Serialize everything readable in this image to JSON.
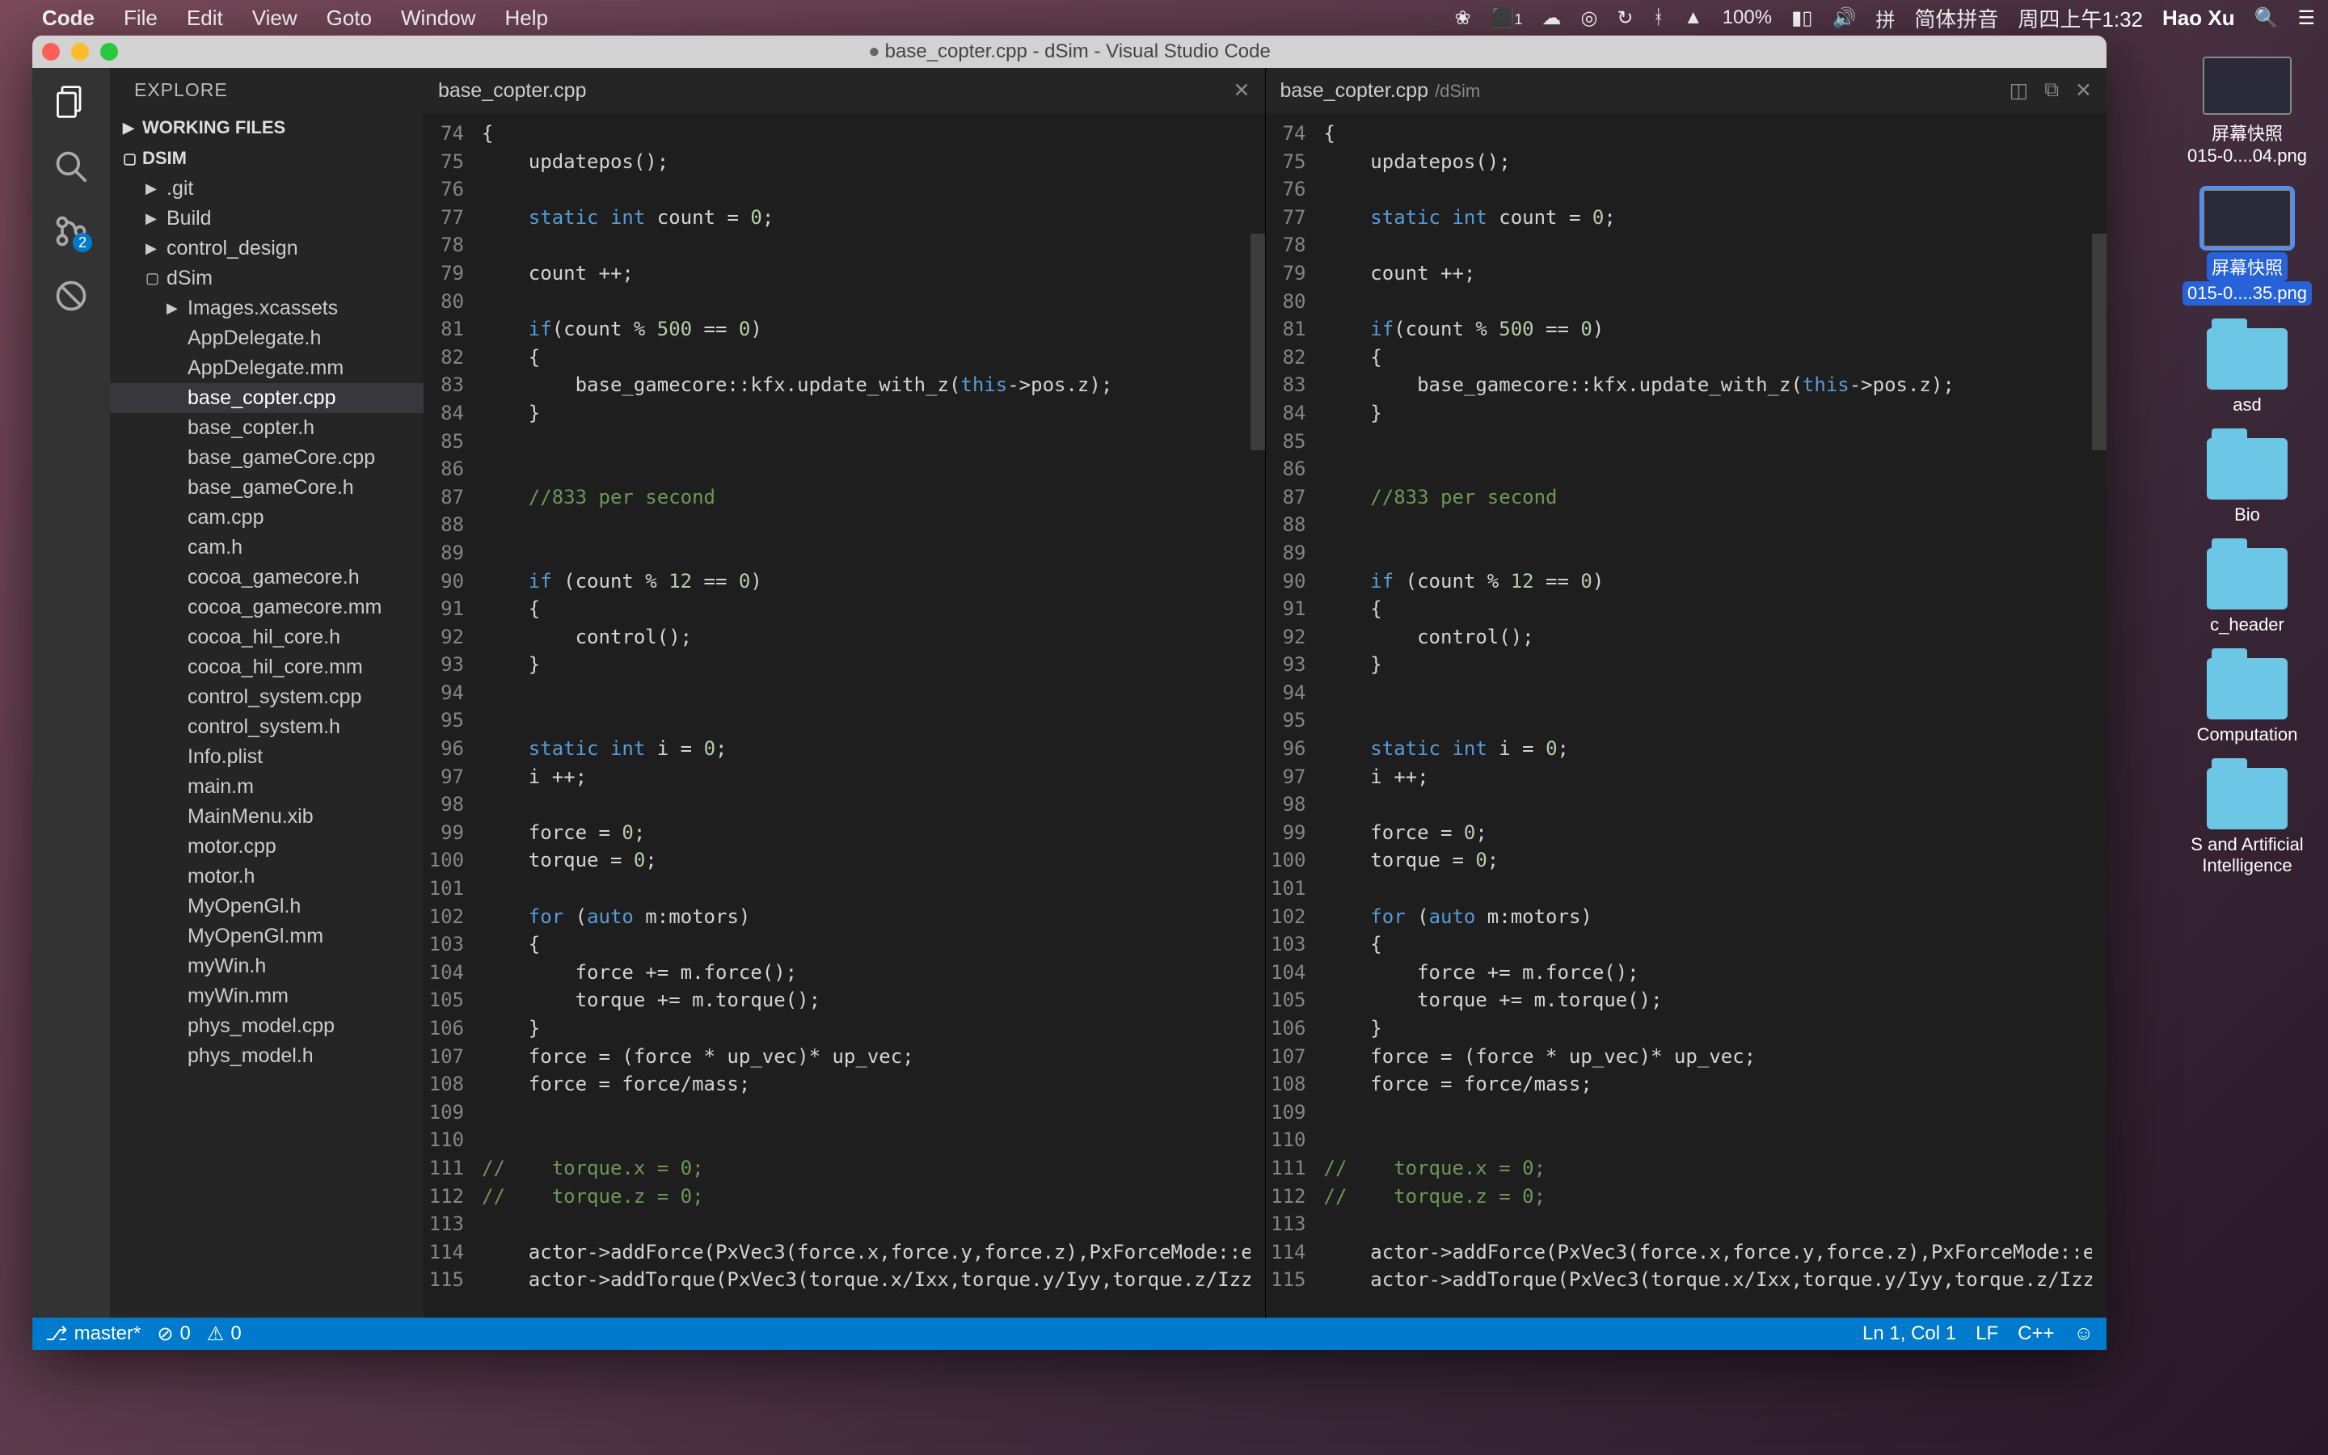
{
  "menubar": {
    "app": "Code",
    "items": [
      "File",
      "Edit",
      "View",
      "Goto",
      "Window",
      "Help"
    ],
    "right": {
      "adobe_badge": "1",
      "battery": "100%",
      "ime": "简体拼音",
      "datetime": "周四上午1:32",
      "user": "Hao Xu"
    }
  },
  "titlebar": "base_copter.cpp - dSim - Visual Studio Code",
  "activity": {
    "git_badge": "2"
  },
  "sidebar": {
    "title": "EXPLORE",
    "sections": {
      "working": "WORKING FILES",
      "project": "DSIM"
    },
    "tree": [
      {
        "label": ".git",
        "indent": 1,
        "folder": true,
        "collapsed": true
      },
      {
        "label": "Build",
        "indent": 1,
        "folder": true,
        "collapsed": true
      },
      {
        "label": "control_design",
        "indent": 1,
        "folder": true,
        "collapsed": true
      },
      {
        "label": "dSim",
        "indent": 1,
        "folder": true,
        "collapsed": false
      },
      {
        "label": "Images.xcassets",
        "indent": 2,
        "folder": true,
        "collapsed": true
      },
      {
        "label": "AppDelegate.h",
        "indent": 2
      },
      {
        "label": "AppDelegate.mm",
        "indent": 2
      },
      {
        "label": "base_copter.cpp",
        "indent": 2,
        "selected": true
      },
      {
        "label": "base_copter.h",
        "indent": 2
      },
      {
        "label": "base_gameCore.cpp",
        "indent": 2
      },
      {
        "label": "base_gameCore.h",
        "indent": 2
      },
      {
        "label": "cam.cpp",
        "indent": 2
      },
      {
        "label": "cam.h",
        "indent": 2
      },
      {
        "label": "cocoa_gamecore.h",
        "indent": 2
      },
      {
        "label": "cocoa_gamecore.mm",
        "indent": 2
      },
      {
        "label": "cocoa_hil_core.h",
        "indent": 2
      },
      {
        "label": "cocoa_hil_core.mm",
        "indent": 2
      },
      {
        "label": "control_system.cpp",
        "indent": 2
      },
      {
        "label": "control_system.h",
        "indent": 2
      },
      {
        "label": "Info.plist",
        "indent": 2
      },
      {
        "label": "main.m",
        "indent": 2
      },
      {
        "label": "MainMenu.xib",
        "indent": 2
      },
      {
        "label": "motor.cpp",
        "indent": 2
      },
      {
        "label": "motor.h",
        "indent": 2
      },
      {
        "label": "MyOpenGl.h",
        "indent": 2
      },
      {
        "label": "MyOpenGl.mm",
        "indent": 2
      },
      {
        "label": "myWin.h",
        "indent": 2
      },
      {
        "label": "myWin.mm",
        "indent": 2
      },
      {
        "label": "phys_model.cpp",
        "indent": 2
      },
      {
        "label": "phys_model.h",
        "indent": 2
      }
    ]
  },
  "panes": {
    "left": {
      "tab": "base_copter.cpp",
      "sub": ""
    },
    "right": {
      "tab": "base_copter.cpp",
      "sub": "/dSim"
    }
  },
  "status": {
    "branch": "master*",
    "errors": "0",
    "warnings": "0",
    "ln": "Ln 1, Col 1",
    "eol": "LF",
    "lang": "C++"
  },
  "code": {
    "first_line": 74,
    "lines": [
      {
        "n": 74,
        "t": [
          [
            "op",
            "{"
          ]
        ]
      },
      {
        "n": 75,
        "t": [
          [
            "op",
            "    updatepos();"
          ]
        ]
      },
      {
        "n": 76,
        "t": []
      },
      {
        "n": 77,
        "t": [
          [
            "op",
            "    "
          ],
          [
            "kw",
            "static"
          ],
          [
            "op",
            " "
          ],
          [
            "ty",
            "int"
          ],
          [
            "op",
            " count = "
          ],
          [
            "num",
            "0"
          ],
          [
            "op",
            ";"
          ]
        ]
      },
      {
        "n": 78,
        "t": []
      },
      {
        "n": 79,
        "t": [
          [
            "op",
            "    count ++;"
          ]
        ]
      },
      {
        "n": 80,
        "t": []
      },
      {
        "n": 81,
        "t": [
          [
            "op",
            "    "
          ],
          [
            "kw",
            "if"
          ],
          [
            "op",
            "(count % "
          ],
          [
            "num",
            "500"
          ],
          [
            "op",
            " == "
          ],
          [
            "num",
            "0"
          ],
          [
            "op",
            ")"
          ]
        ]
      },
      {
        "n": 82,
        "t": [
          [
            "op",
            "    {"
          ]
        ]
      },
      {
        "n": 83,
        "t": [
          [
            "op",
            "        base_gamecore::kfx.update_with_z("
          ],
          [
            "this",
            "this"
          ],
          [
            "op",
            "->pos.z);"
          ]
        ]
      },
      {
        "n": 84,
        "t": [
          [
            "op",
            "    }"
          ]
        ]
      },
      {
        "n": 85,
        "t": []
      },
      {
        "n": 86,
        "t": []
      },
      {
        "n": 87,
        "t": [
          [
            "op",
            "    "
          ],
          [
            "cm",
            "//833 per second"
          ]
        ]
      },
      {
        "n": 88,
        "t": []
      },
      {
        "n": 89,
        "t": []
      },
      {
        "n": 90,
        "t": [
          [
            "op",
            "    "
          ],
          [
            "kw",
            "if"
          ],
          [
            "op",
            " (count % "
          ],
          [
            "num",
            "12"
          ],
          [
            "op",
            " == "
          ],
          [
            "num",
            "0"
          ],
          [
            "op",
            ")"
          ]
        ]
      },
      {
        "n": 91,
        "t": [
          [
            "op",
            "    {"
          ]
        ]
      },
      {
        "n": 92,
        "t": [
          [
            "op",
            "        control();"
          ]
        ]
      },
      {
        "n": 93,
        "t": [
          [
            "op",
            "    }"
          ]
        ]
      },
      {
        "n": 94,
        "t": []
      },
      {
        "n": 95,
        "t": []
      },
      {
        "n": 96,
        "t": [
          [
            "op",
            "    "
          ],
          [
            "kw",
            "static"
          ],
          [
            "op",
            " "
          ],
          [
            "ty",
            "int"
          ],
          [
            "op",
            " i = "
          ],
          [
            "num",
            "0"
          ],
          [
            "op",
            ";"
          ]
        ]
      },
      {
        "n": 97,
        "t": [
          [
            "op",
            "    i ++;"
          ]
        ]
      },
      {
        "n": 98,
        "t": []
      },
      {
        "n": 99,
        "t": [
          [
            "op",
            "    force = "
          ],
          [
            "num",
            "0"
          ],
          [
            "op",
            ";"
          ]
        ]
      },
      {
        "n": 100,
        "t": [
          [
            "op",
            "    torque = "
          ],
          [
            "num",
            "0"
          ],
          [
            "op",
            ";"
          ]
        ]
      },
      {
        "n": 101,
        "t": []
      },
      {
        "n": 102,
        "t": [
          [
            "op",
            "    "
          ],
          [
            "kw",
            "for"
          ],
          [
            "op",
            " ("
          ],
          [
            "ty",
            "auto"
          ],
          [
            "op",
            " m:motors)"
          ]
        ]
      },
      {
        "n": 103,
        "t": [
          [
            "op",
            "    {"
          ]
        ]
      },
      {
        "n": 104,
        "t": [
          [
            "op",
            "        force += m.force();"
          ]
        ]
      },
      {
        "n": 105,
        "t": [
          [
            "op",
            "        torque += m.torque();"
          ]
        ]
      },
      {
        "n": 106,
        "t": [
          [
            "op",
            "    }"
          ]
        ]
      },
      {
        "n": 107,
        "t": [
          [
            "op",
            "    force = (force * up_vec)* up_vec;"
          ]
        ]
      },
      {
        "n": 108,
        "t": [
          [
            "op",
            "    force = force/mass;"
          ]
        ]
      },
      {
        "n": 109,
        "t": []
      },
      {
        "n": 110,
        "t": []
      },
      {
        "n": 111,
        "t": [
          [
            "cm",
            "//    torque.x = 0;"
          ]
        ]
      },
      {
        "n": 112,
        "t": [
          [
            "cm",
            "//    torque.z = 0;"
          ]
        ]
      },
      {
        "n": 113,
        "t": []
      },
      {
        "n": 114,
        "t": [
          [
            "op",
            "    actor->addForce(PxVec3(force.x,force.y,force.z),PxForceMode::eACCELERATION);"
          ]
        ]
      },
      {
        "n": 115,
        "t": [
          [
            "op",
            "    actor->addTorque(PxVec3(torque.x/Ixx,torque.y/Iyy,torque.z/Izz),PxForceMode::eACCELERATION);"
          ]
        ]
      }
    ]
  },
  "desktop": [
    {
      "type": "thumb",
      "name": "屏幕快照",
      "sub": "015-0....04.png"
    },
    {
      "type": "thumb",
      "name": "屏幕快照",
      "sub": "015-0....35.png",
      "selected": true
    },
    {
      "type": "folder",
      "name": "asd"
    },
    {
      "type": "folder",
      "name": "Bio"
    },
    {
      "type": "folder",
      "name": "c_header"
    },
    {
      "type": "folder",
      "name": "Computation"
    },
    {
      "type": "folder",
      "name": "S and Artificial Intelligence"
    }
  ]
}
